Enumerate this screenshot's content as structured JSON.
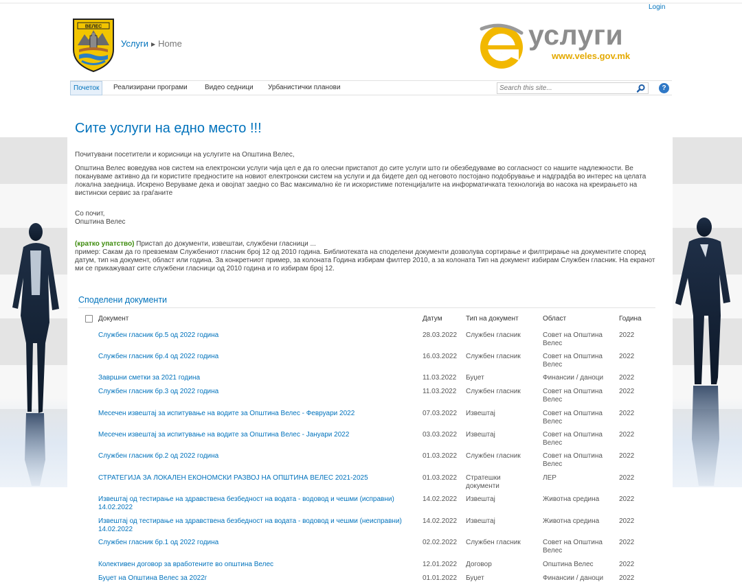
{
  "header": {
    "login": "Login",
    "breadcrumb_site": "Услуги",
    "breadcrumb_page": "Home",
    "coat_text": "ВЕЛЕС",
    "brand_letter": "e",
    "brand_word": "услуги",
    "brand_url": "www.veles.gov.mk"
  },
  "nav": {
    "items": [
      {
        "label": "Почеток",
        "active": true
      },
      {
        "label": "Реализирани програми"
      },
      {
        "label": "Видео седници"
      },
      {
        "label": "Урбанистички планови"
      }
    ],
    "search_placeholder": "Search this site...",
    "help": "?"
  },
  "main": {
    "title": "Сите услуги на едно место !!!",
    "greeting": "Почитувани посетители и корисници на услугите на Општина Велес,",
    "intro": "Општина Велес воведува нов систем на електронски услуги чија цел е да го олесни пристапот до сите услуги што ги обезбедуваме во согласност со нашите надлежности. Ве покануваме активно да ги користите предностите на новиот електронски систем на услуги и да бидете дел од неговото постојано подобрување и надградба во интерес на целата локална заедница. Искрено Веруваме дека и овојпат  заедно со Вас максимално ќе ги искористиме потенцијалите на информатичката технологија во насока на креирањето на вистински сервис за граѓаните",
    "regards": "Со почит,",
    "signature": "Општина Велес",
    "howto_label": "(кратко упатство)",
    "howto_title": " Пристап до документи, извештаи, службени гласници ...",
    "howto_text": "пример: Сакам да го превземам Службениот гласник број 12 од 2010 година. Библиотеката на споделени документи дозволува сортирање и филтрирање на документите според датум, тип на документ, област или година. За конкретниот пример, за колоната Година избирам филтер 2010, а за колоната Тип на документ избирам Службен гласник. На екранот ми се прикажуваат сите службени гласници од 2010 година и го избирам број 12."
  },
  "library": {
    "title": "Споделени документи",
    "columns": [
      "Документ",
      "Датум",
      "Тип на документ",
      "Област",
      "Година"
    ],
    "rows": [
      {
        "doc": "Службен гласник бр.5 од 2022 година",
        "date": "28.03.2022",
        "type": "Службен гласник",
        "area": "Совет на Општина Велес",
        "year": "2022"
      },
      {
        "doc": "Службен гласник бр.4 од 2022 година",
        "date": "16.03.2022",
        "type": "Службен гласник",
        "area": "Совет на Општина Велес",
        "year": "2022"
      },
      {
        "doc": "Завршни сметки за 2021 година",
        "date": "11.03.2022",
        "type": "Буџет",
        "area": "Финансии / даноци",
        "year": "2022"
      },
      {
        "doc": "Службен гласник бр.3 од 2022 година",
        "date": "11.03.2022",
        "type": "Службен гласник",
        "area": "Совет на Општина Велес",
        "year": "2022"
      },
      {
        "doc": "Месечен извештај за испитување на водите за Општина Велес - Февруари 2022",
        "date": "07.03.2022",
        "type": "Извештај",
        "area": "Совет на Општина Велес",
        "year": "2022"
      },
      {
        "doc": "Месечен извештај за испитување на водите за Општина Велес - Јануари 2022",
        "date": "03.03.2022",
        "type": "Извештај",
        "area": "Совет на Општина Велес",
        "year": "2022"
      },
      {
        "doc": "Службен гласник бр.2 од 2022 година",
        "date": "01.03.2022",
        "type": "Службен гласник",
        "area": "Совет на Општина Велес",
        "year": "2022"
      },
      {
        "doc": "СТРАТЕГИЈА ЗА ЛОКАЛЕН ЕКОНОМСКИ РАЗВОЈ НА ОПШТИНА ВЕЛЕС 2021-2025",
        "date": "01.03.2022",
        "type": "Стратешки документи",
        "area": "ЛЕР",
        "year": "2022"
      },
      {
        "doc": "Извештај од тестирање на здравствена безбедност на водата - водовод и чешми (исправни) 14.02.2022",
        "date": "14.02.2022",
        "type": "Извештај",
        "area": "Животна средина",
        "year": "2022"
      },
      {
        "doc": "Извештај од тестирање на здравствена безбедност на водата - водовод и чешми (неисправни) 14.02.2022",
        "date": "14.02.2022",
        "type": "Извештај",
        "area": "Животна средина",
        "year": "2022"
      },
      {
        "doc": "Службен гласник бр.1 од 2022 година",
        "date": "02.02.2022",
        "type": "Службен гласник",
        "area": "Совет на Општина Велес",
        "year": "2022"
      },
      {
        "doc": "Колективен договор за вработените во општина Велес",
        "date": "12.01.2022",
        "type": "Договор",
        "area": "Општина Велес",
        "year": "2022"
      },
      {
        "doc": "Буџет на Општина Велес за 2022г",
        "date": "01.01.2022",
        "type": "Буџет",
        "area": "Финансии / даноци",
        "year": "2022"
      }
    ]
  }
}
